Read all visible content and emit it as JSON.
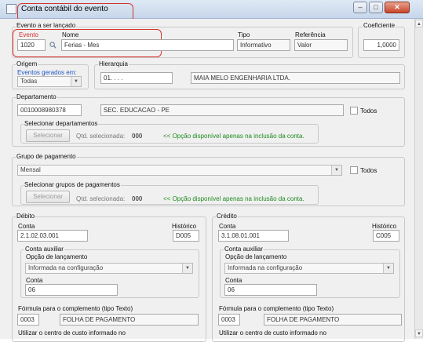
{
  "window": {
    "title": "Conta contábil do evento",
    "minimize": "–",
    "maximize": "□",
    "close": "✕"
  },
  "evento_group": {
    "label": "Evento a ser lançado",
    "evento_label": "Evento",
    "evento_value": "1020",
    "nome_label": "Nome",
    "nome_value": "Ferias - Mes",
    "tipo_label": "Tipo",
    "tipo_value": "Informativo",
    "referencia_label": "Referência",
    "referencia_value": "Valor"
  },
  "coeficiente": {
    "label": "Coeficiente",
    "value": "1,0000"
  },
  "origem": {
    "label": "Origem",
    "sublabel": "Eventos gerados em:",
    "value": "Todas"
  },
  "hierarquia": {
    "label": "Hierarquia",
    "code": "01.  .  .  .",
    "name": "MAIA MELO ENGENHARIA LTDA."
  },
  "departamento": {
    "label": "Departamento",
    "code": "0010008980378",
    "name": "SEC. EDUCACAO - PE",
    "todos_label": "Todos",
    "select_group_label": "Selecionar departamentos",
    "select_button": "Selecionar",
    "qtd_label": "Qtd. selecionada:",
    "qtd_value": "000",
    "note": "<< Opção disponível apenas na inclusão da conta."
  },
  "grupo_pagamento": {
    "label": "Grupo de pagamento",
    "value": "Mensal",
    "todos_label": "Todos",
    "select_group_label": "Selecionar grupos de pagamentos",
    "select_button": "Selecionar",
    "qtd_label": "Qtd. selecionada:",
    "qtd_value": "000",
    "note": "<< Opção disponível apenas na inclusão da conta."
  },
  "debito": {
    "label": "Débito",
    "conta_label": "Conta",
    "conta_value": "2.1.02.03.001",
    "historico_label": "Histórico",
    "historico_value": "D005",
    "aux_label": "Conta auxiliar",
    "opcao_label": "Opção de lançamento",
    "opcao_value": "Informada na configuração",
    "aux_conta_label": "Conta",
    "aux_conta_value": "06",
    "formula_label": "Fórmula para o complemento (tipo Texto)",
    "formula_code": "0003",
    "formula_name": "FOLHA DE PAGAMENTO",
    "centro_label": "Utilizar o centro de custo informado no"
  },
  "credito": {
    "label": "Crédito",
    "conta_label": "Conta",
    "conta_value": "3.1.08.01.001",
    "historico_label": "Histórico",
    "historico_value": "C005",
    "aux_label": "Conta auxiliar",
    "opcao_label": "Opção de lançamento",
    "opcao_value": "Informada na configuração",
    "aux_conta_label": "Conta",
    "aux_conta_value": "06",
    "formula_label": "Fórmula para o complemento (tipo Texto)",
    "formula_code": "0003",
    "formula_name": "FOLHA DE PAGAMENTO",
    "centro_label": "Utilizar o centro de custo informado no"
  }
}
